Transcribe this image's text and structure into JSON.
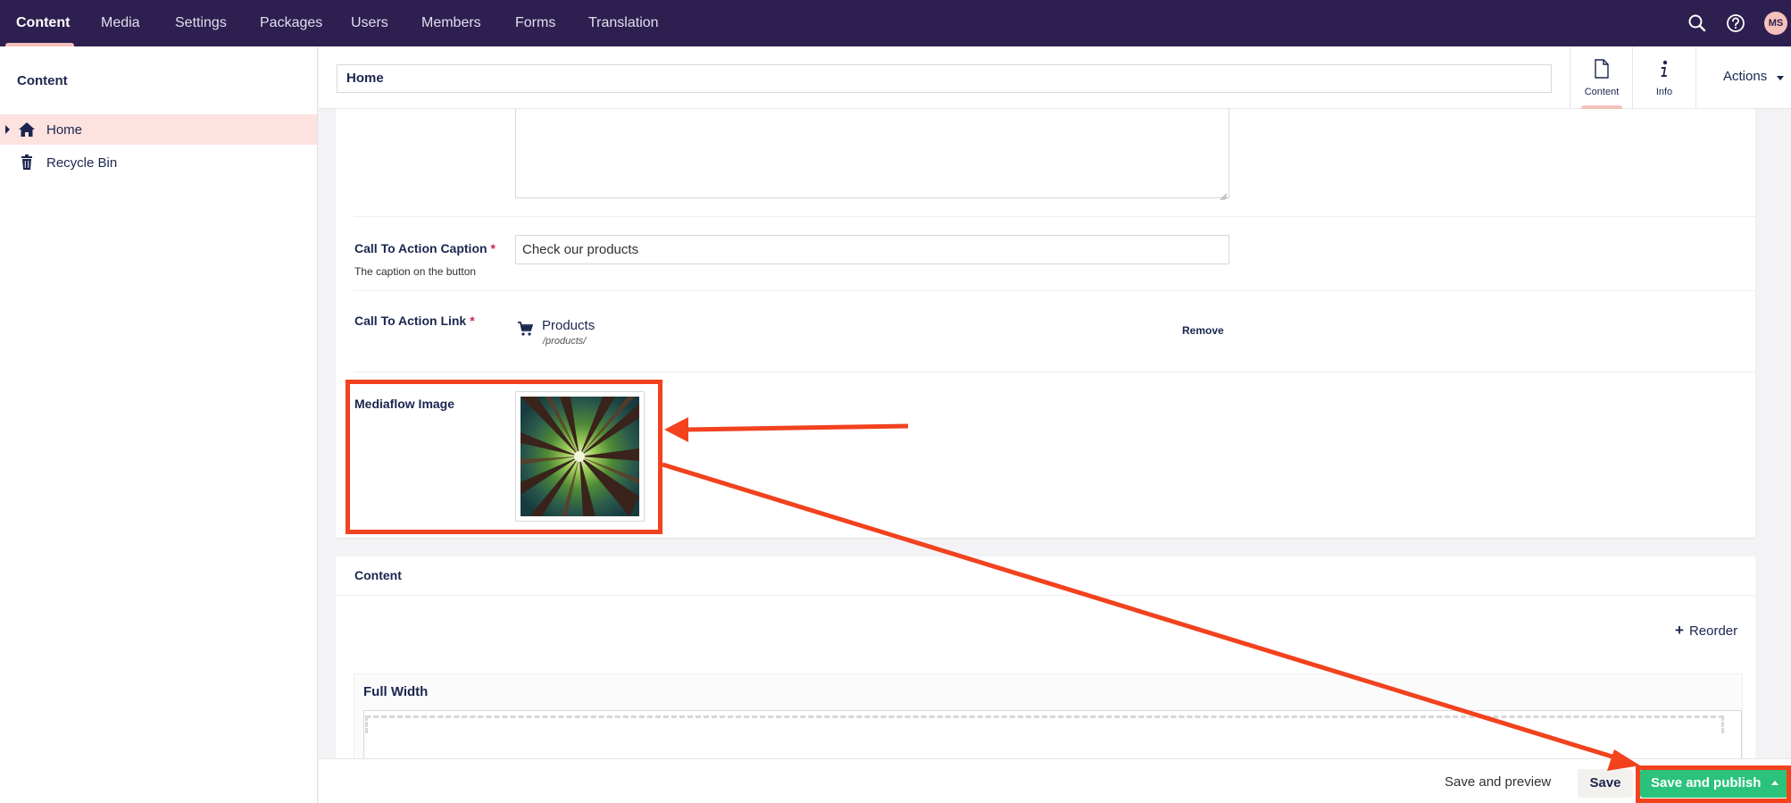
{
  "topnav": {
    "sections": [
      "Content",
      "Media",
      "Settings",
      "Packages",
      "Users",
      "Members",
      "Forms",
      "Translation"
    ],
    "active": "Content",
    "avatar_initials": "MS",
    "colors": {
      "bar": "#2d1f4f",
      "accent": "#f5c1bc"
    }
  },
  "tree": {
    "title": "Content",
    "nodes": [
      {
        "label": "Home",
        "icon": "home-icon",
        "selected": true
      },
      {
        "label": "Recycle Bin",
        "icon": "trash-icon",
        "selected": false
      }
    ]
  },
  "editor": {
    "name_value": "Home",
    "apps": [
      {
        "label": "Content",
        "icon": "document-icon",
        "active": true
      },
      {
        "label": "Info",
        "icon": "info-icon",
        "active": false
      }
    ],
    "actions_label": "Actions"
  },
  "properties": {
    "cta_caption": {
      "label": "Call To Action Caption",
      "required_mark": "*",
      "description": "The caption on the button",
      "value": "Check our products"
    },
    "cta_link": {
      "label": "Call To Action Link",
      "required_mark": "*",
      "link_name": "Products",
      "link_url": "/products/",
      "remove_label": "Remove",
      "icon": "cart-icon"
    },
    "mediaflow_image": {
      "label": "Mediaflow Image"
    }
  },
  "content_section": {
    "title": "Content",
    "reorder_label": "Reorder",
    "area_title": "Full Width"
  },
  "footer": {
    "preview_label": "Save and preview",
    "save_label": "Save",
    "publish_label": "Save and publish",
    "colors": {
      "publish": "#2bc37c",
      "save": "#f3f1ee"
    }
  },
  "annotation_color": "#f2421e"
}
